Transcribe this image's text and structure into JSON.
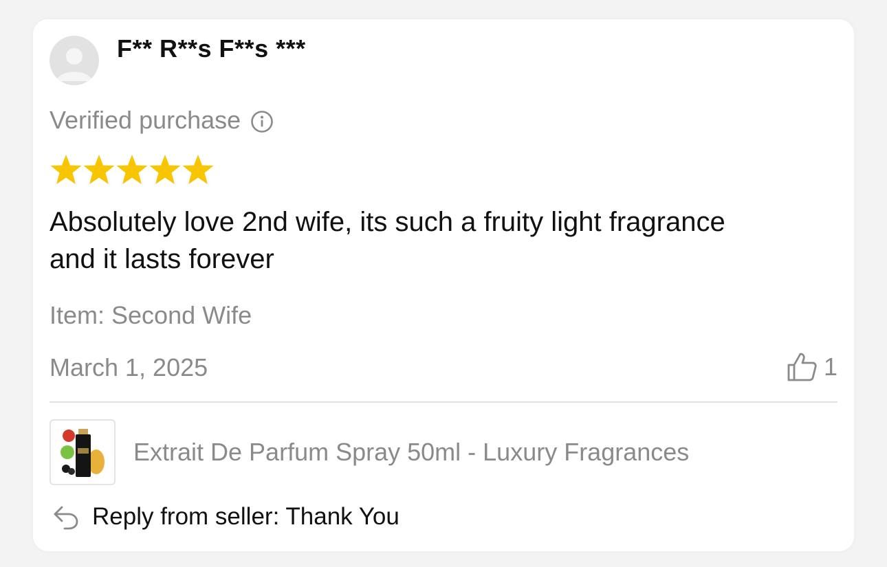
{
  "review": {
    "username": "F** R**s F**s ***",
    "verified_label": "Verified purchase",
    "rating": 5,
    "rating_max": 5,
    "text": "Absolutely love 2nd wife, its such a fruity light fragrance and it lasts forever",
    "item_label": "Item: Second Wife",
    "date": "March 1, 2025",
    "helpful_count": "1"
  },
  "product": {
    "title": "Extrait De Parfum Spray 50ml - Luxury Fragrances"
  },
  "reply": {
    "text": "Reply from seller: Thank You"
  },
  "icons": {
    "avatar": "user-placeholder-icon",
    "info": "info-circle-icon",
    "star": "star-icon",
    "helpful": "thumbs-up-icon",
    "reply": "reply-arrow-icon"
  },
  "colors": {
    "star": "#f7c600",
    "muted_text": "#8a8a8a",
    "primary_text": "#111111"
  }
}
